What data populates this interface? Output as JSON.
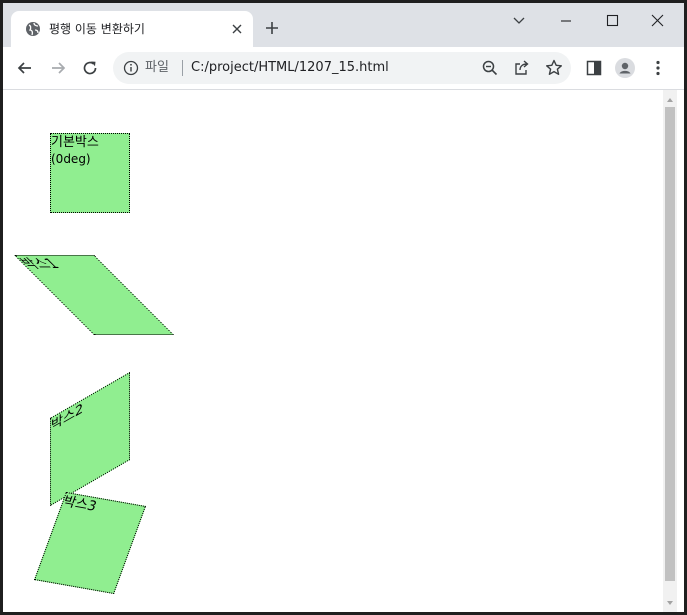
{
  "tab": {
    "title": "평행 이동 변환하기",
    "favicon": "globe-icon",
    "close_icon": "close-icon"
  },
  "newtab_icon": "plus-icon",
  "window_controls": [
    "chevron-down-icon",
    "minimize-icon",
    "maximize-icon",
    "close-icon"
  ],
  "toolbar": {
    "back_icon": "arrow-left-icon",
    "forward_icon": "arrow-right-icon",
    "reload_icon": "reload-icon",
    "omnibox": {
      "info_icon": "info-icon",
      "scheme_label": "파일",
      "url": "C:/project/HTML/1207_15.html",
      "actions": [
        "zoom-out-icon",
        "share-icon",
        "star-icon"
      ]
    },
    "side_panel_icon": "side-panel-icon",
    "profile_icon": "avatar-icon",
    "menu_icon": "kebab-menu-icon"
  },
  "page": {
    "boxes": [
      {
        "line1": "기본박스",
        "line2": "(0deg)"
      },
      {
        "label": "박스1"
      },
      {
        "label": "박스2"
      },
      {
        "label": "박스3"
      }
    ],
    "box_color": "#90ee90"
  },
  "colors": {
    "tabstrip_bg": "#dee1e6",
    "omnibox_bg": "#f1f3f4",
    "scrollbar_thumb": "#c1c1c1"
  }
}
